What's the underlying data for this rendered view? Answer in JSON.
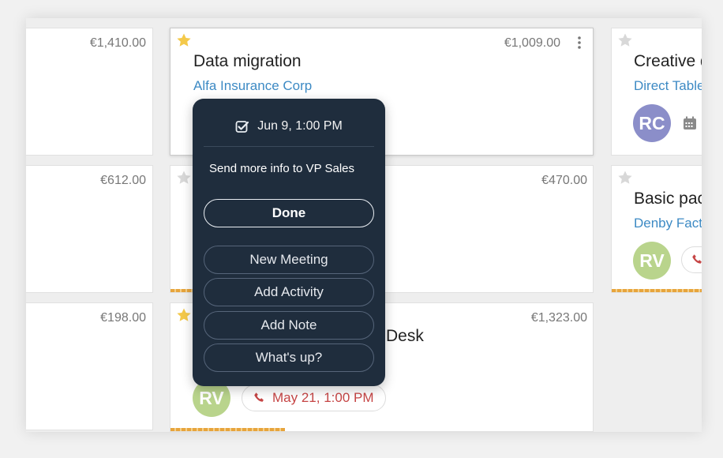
{
  "cards": {
    "r1c1": {
      "amount": "€1,410.00"
    },
    "r1c2": {
      "amount": "€1,009.00",
      "title": "Data migration",
      "company": "Alfa Insurance Corp"
    },
    "r1c3": {
      "title": "Creative d",
      "company": "Direct Table",
      "avatar_initials": "RC"
    },
    "r2c1": {
      "amount": "€612.00"
    },
    "r2c2": {
      "amount": "€470.00"
    },
    "r2c3": {
      "title": "Basic pack",
      "company": "Denby Facto",
      "avatar_initials": "RV"
    },
    "r3c1": {
      "amount": "€198.00"
    },
    "r3c2": {
      "amount": "€1,323.00",
      "title_fragment": "Desk",
      "avatar_initials": "RV",
      "activity_date": "May 21, 1:00 PM"
    }
  },
  "popover": {
    "date": "Jun 9, 1:00 PM",
    "subject": "Send more info to VP Sales",
    "done_label": "Done",
    "new_meeting_label": "New Meeting",
    "add_activity_label": "Add Activity",
    "add_note_label": "Add Note",
    "whats_up_label": "What's up?"
  },
  "colors": {
    "popover_bg": "#1f2d3d",
    "link": "#3d8ac4",
    "star_active": "#f4c94a",
    "star_inactive": "#d8d8d8",
    "avatar_rc": "#8b8ec9",
    "avatar_rv": "#b9d48c",
    "phone_red": "#c64545",
    "progress": "#e7a43c"
  },
  "icons": [
    "star-icon",
    "kebab-menu-icon",
    "calendar-icon",
    "phone-icon",
    "check-box-icon"
  ]
}
